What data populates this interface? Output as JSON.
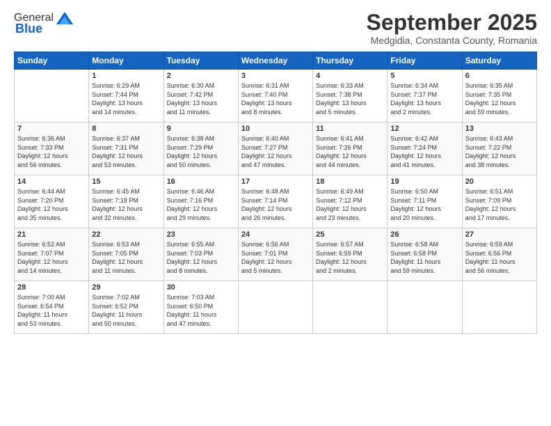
{
  "header": {
    "logo_general": "General",
    "logo_blue": "Blue",
    "month_title": "September 2025",
    "location": "Medgidia, Constanta County, Romania"
  },
  "weekdays": [
    "Sunday",
    "Monday",
    "Tuesday",
    "Wednesday",
    "Thursday",
    "Friday",
    "Saturday"
  ],
  "weeks": [
    [
      {
        "day": "",
        "info": ""
      },
      {
        "day": "1",
        "info": "Sunrise: 6:29 AM\nSunset: 7:44 PM\nDaylight: 13 hours\nand 14 minutes."
      },
      {
        "day": "2",
        "info": "Sunrise: 6:30 AM\nSunset: 7:42 PM\nDaylight: 13 hours\nand 11 minutes."
      },
      {
        "day": "3",
        "info": "Sunrise: 6:31 AM\nSunset: 7:40 PM\nDaylight: 13 hours\nand 8 minutes."
      },
      {
        "day": "4",
        "info": "Sunrise: 6:33 AM\nSunset: 7:38 PM\nDaylight: 13 hours\nand 5 minutes."
      },
      {
        "day": "5",
        "info": "Sunrise: 6:34 AM\nSunset: 7:37 PM\nDaylight: 13 hours\nand 2 minutes."
      },
      {
        "day": "6",
        "info": "Sunrise: 6:35 AM\nSunset: 7:35 PM\nDaylight: 12 hours\nand 59 minutes."
      }
    ],
    [
      {
        "day": "7",
        "info": "Sunrise: 6:36 AM\nSunset: 7:33 PM\nDaylight: 12 hours\nand 56 minutes."
      },
      {
        "day": "8",
        "info": "Sunrise: 6:37 AM\nSunset: 7:31 PM\nDaylight: 12 hours\nand 53 minutes."
      },
      {
        "day": "9",
        "info": "Sunrise: 6:38 AM\nSunset: 7:29 PM\nDaylight: 12 hours\nand 50 minutes."
      },
      {
        "day": "10",
        "info": "Sunrise: 6:40 AM\nSunset: 7:27 PM\nDaylight: 12 hours\nand 47 minutes."
      },
      {
        "day": "11",
        "info": "Sunrise: 6:41 AM\nSunset: 7:26 PM\nDaylight: 12 hours\nand 44 minutes."
      },
      {
        "day": "12",
        "info": "Sunrise: 6:42 AM\nSunset: 7:24 PM\nDaylight: 12 hours\nand 41 minutes."
      },
      {
        "day": "13",
        "info": "Sunrise: 6:43 AM\nSunset: 7:22 PM\nDaylight: 12 hours\nand 38 minutes."
      }
    ],
    [
      {
        "day": "14",
        "info": "Sunrise: 6:44 AM\nSunset: 7:20 PM\nDaylight: 12 hours\nand 35 minutes."
      },
      {
        "day": "15",
        "info": "Sunrise: 6:45 AM\nSunset: 7:18 PM\nDaylight: 12 hours\nand 32 minutes."
      },
      {
        "day": "16",
        "info": "Sunrise: 6:46 AM\nSunset: 7:16 PM\nDaylight: 12 hours\nand 29 minutes."
      },
      {
        "day": "17",
        "info": "Sunrise: 6:48 AM\nSunset: 7:14 PM\nDaylight: 12 hours\nand 26 minutes."
      },
      {
        "day": "18",
        "info": "Sunrise: 6:49 AM\nSunset: 7:12 PM\nDaylight: 12 hours\nand 23 minutes."
      },
      {
        "day": "19",
        "info": "Sunrise: 6:50 AM\nSunset: 7:11 PM\nDaylight: 12 hours\nand 20 minutes."
      },
      {
        "day": "20",
        "info": "Sunrise: 6:51 AM\nSunset: 7:09 PM\nDaylight: 12 hours\nand 17 minutes."
      }
    ],
    [
      {
        "day": "21",
        "info": "Sunrise: 6:52 AM\nSunset: 7:07 PM\nDaylight: 12 hours\nand 14 minutes."
      },
      {
        "day": "22",
        "info": "Sunrise: 6:53 AM\nSunset: 7:05 PM\nDaylight: 12 hours\nand 11 minutes."
      },
      {
        "day": "23",
        "info": "Sunrise: 6:55 AM\nSunset: 7:03 PM\nDaylight: 12 hours\nand 8 minutes."
      },
      {
        "day": "24",
        "info": "Sunrise: 6:56 AM\nSunset: 7:01 PM\nDaylight: 12 hours\nand 5 minutes."
      },
      {
        "day": "25",
        "info": "Sunrise: 6:57 AM\nSunset: 6:59 PM\nDaylight: 12 hours\nand 2 minutes."
      },
      {
        "day": "26",
        "info": "Sunrise: 6:58 AM\nSunset: 6:58 PM\nDaylight: 11 hours\nand 59 minutes."
      },
      {
        "day": "27",
        "info": "Sunrise: 6:59 AM\nSunset: 6:56 PM\nDaylight: 11 hours\nand 56 minutes."
      }
    ],
    [
      {
        "day": "28",
        "info": "Sunrise: 7:00 AM\nSunset: 6:54 PM\nDaylight: 11 hours\nand 53 minutes."
      },
      {
        "day": "29",
        "info": "Sunrise: 7:02 AM\nSunset: 6:52 PM\nDaylight: 11 hours\nand 50 minutes."
      },
      {
        "day": "30",
        "info": "Sunrise: 7:03 AM\nSunset: 6:50 PM\nDaylight: 11 hours\nand 47 minutes."
      },
      {
        "day": "",
        "info": ""
      },
      {
        "day": "",
        "info": ""
      },
      {
        "day": "",
        "info": ""
      },
      {
        "day": "",
        "info": ""
      }
    ]
  ]
}
